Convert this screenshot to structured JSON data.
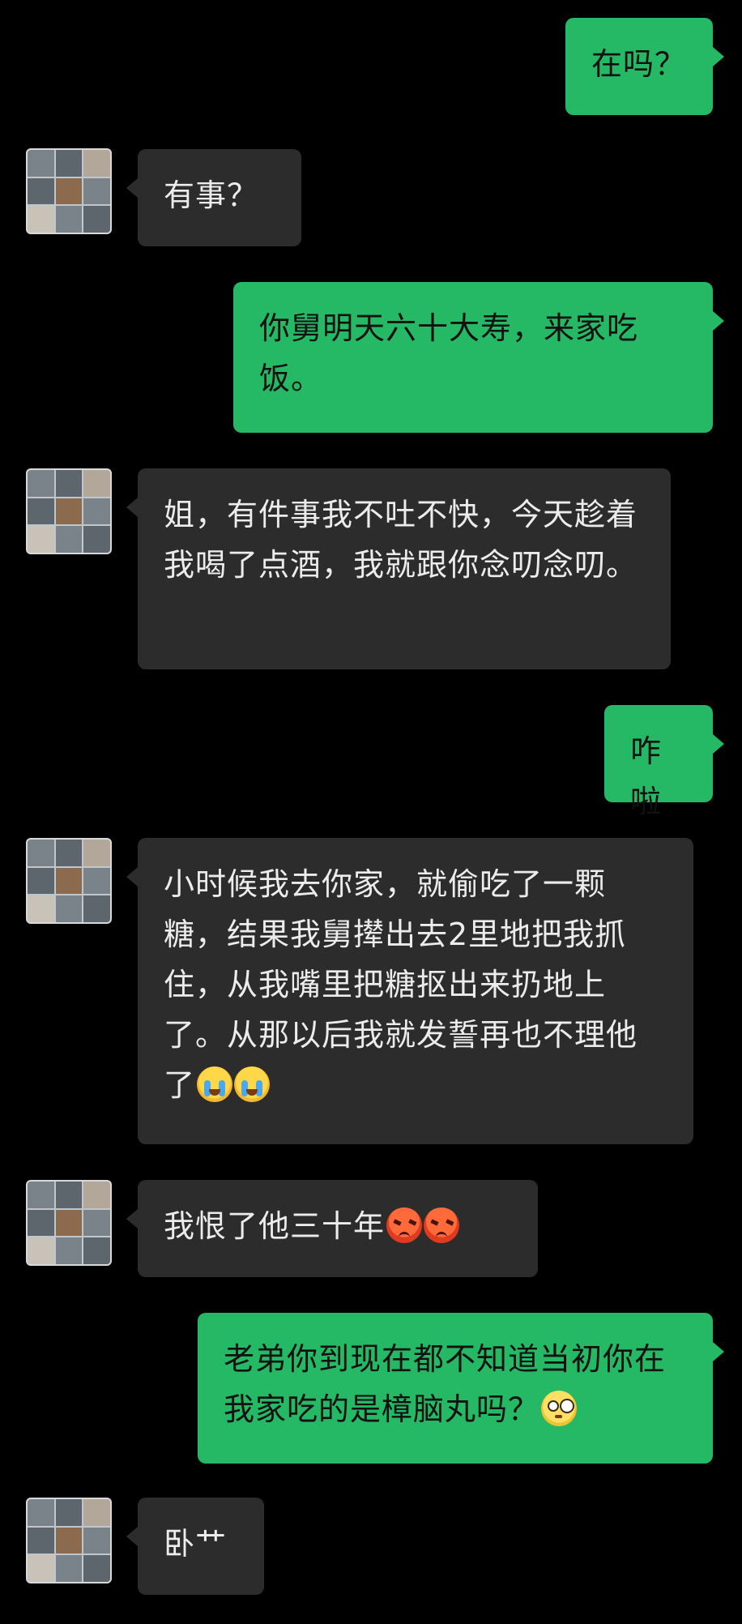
{
  "conversation": {
    "messages": [
      {
        "id": "m1",
        "side": "out",
        "text": "在吗？"
      },
      {
        "id": "m2",
        "side": "in",
        "text": "有事？"
      },
      {
        "id": "m3",
        "side": "out",
        "text": "你舅明天六十大寿，来家吃饭。"
      },
      {
        "id": "m4",
        "side": "in",
        "text": "姐，有件事我不吐不快，今天趁着我喝了点酒，我就跟你念叨念叨。"
      },
      {
        "id": "m5",
        "side": "out",
        "text": "咋啦"
      },
      {
        "id": "m6",
        "side": "in",
        "text": "小时候我去你家，就偷吃了一颗糖，结果我舅撵出去2里地把我抓住，从我嘴里把糖抠出来扔地上了。从那以后我就发誓再也不理他了",
        "emoji": "loudly-crying-face x2"
      },
      {
        "id": "m7",
        "side": "in",
        "text": "我恨了他三十年",
        "emoji": "angry-face x2"
      },
      {
        "id": "m8",
        "side": "out",
        "text": "老弟你到现在都不知道当初你在我家吃的是樟脑丸吗？",
        "emoji": "flushed-face"
      },
      {
        "id": "m9",
        "side": "in",
        "text": "卧艹"
      }
    ]
  },
  "colors": {
    "background": "#000000",
    "incoming_bubble": "#2c2c2c",
    "outgoing_bubble": "#25b865"
  }
}
